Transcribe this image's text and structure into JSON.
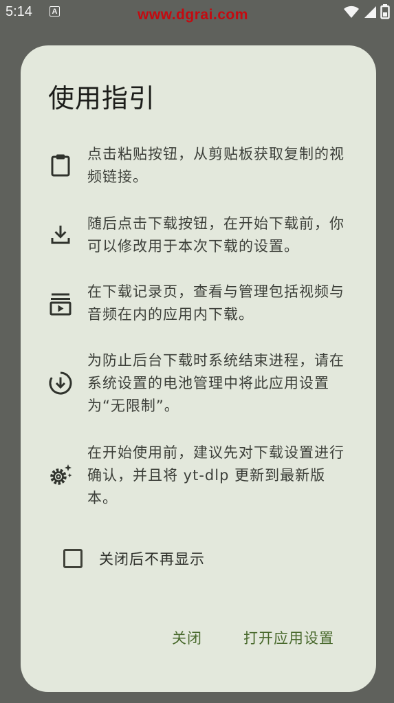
{
  "status_bar": {
    "time": "5:14",
    "notification_icon_letter": "A",
    "watermark": "www.dgrai.com",
    "icons": [
      "wifi-icon",
      "signal-icon",
      "battery-icon"
    ]
  },
  "dialog": {
    "title": "使用指引",
    "items": [
      {
        "icon": "clipboard-icon",
        "text": "点击粘贴按钮，从剪贴板获取复制的视频链接。"
      },
      {
        "icon": "download-icon",
        "text": "随后点击下载按钮，在开始下载前，你可以修改用于本次下载的设置。"
      },
      {
        "icon": "subscriptions-icon",
        "text": "在下载记录页，查看与管理包括视频与音频在内的应用内下载。"
      },
      {
        "icon": "download-circle-icon",
        "text": "为防止后台下载时系统结束进程，请在系统设置的电池管理中将此应用设置为“无限制”。"
      },
      {
        "icon": "settings-sparkle-icon",
        "text": "在开始使用前，建议先对下载设置进行确认，并且将 yt-dlp 更新到最新版本。"
      }
    ],
    "checkbox": {
      "label": "关闭后不再显示",
      "checked": false
    },
    "buttons": {
      "close": "关闭",
      "open_settings": "打开应用设置"
    },
    "colors": {
      "surface": "#e3e8dc",
      "accent": "#4a6a2e",
      "scrim": "#5f615c"
    }
  }
}
